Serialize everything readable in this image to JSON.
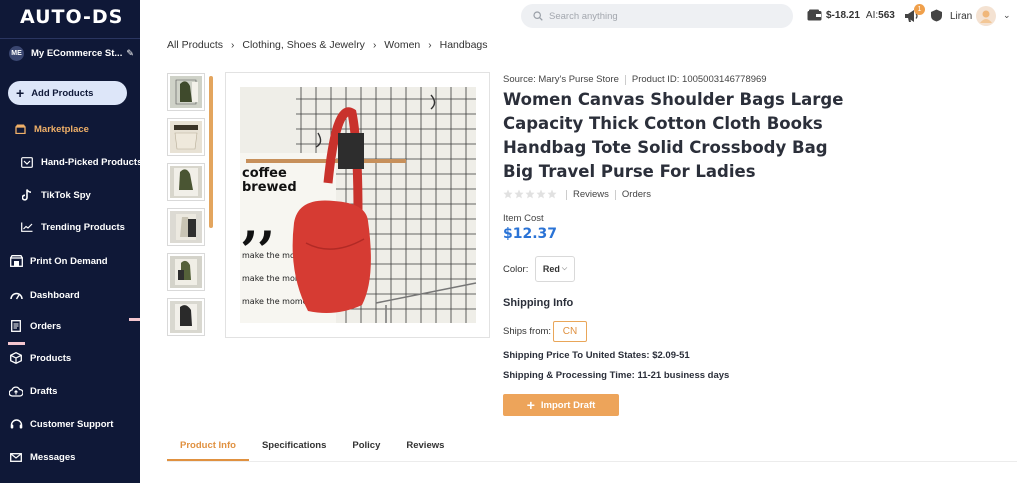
{
  "app": {
    "logo": "AUTO-DS"
  },
  "sidebar": {
    "store_avatar": "ME",
    "store_name": "My ECommerce St...",
    "add_products": "Add Products",
    "marketplace": "Marketplace",
    "hand_picked": "Hand-Picked Products",
    "tiktok_spy": "TikTok Spy",
    "trending": "Trending Products",
    "print_on_demand": "Print On Demand",
    "dashboard": "Dashboard",
    "orders": "Orders",
    "products": "Products",
    "drafts": "Drafts",
    "customer_support": "Customer Support",
    "messages": "Messages"
  },
  "topbar": {
    "search_placeholder": "Search anything",
    "balance": "$-18.21",
    "ai_label": "AI:",
    "ai_count": "563",
    "notification_count": "1",
    "user_name": "Liran"
  },
  "breadcrumb": [
    "All Products",
    "Clothing, Shoes & Jewelry",
    "Women",
    "Handbags"
  ],
  "product": {
    "source_label": "Source:",
    "source": "Mary's Purse Store",
    "id_label": "Product ID:",
    "id": "1005003146778969",
    "title": "Women Canvas Shoulder Bags Large Capacity Thick Cotton Cloth Books Handbag Tote Solid Crossbody Bag Big Travel Purse For Ladies",
    "rating": 0,
    "reviews_label": "Reviews",
    "orders_label": "Orders",
    "item_cost_label": "Item Cost",
    "item_cost": "$12.37",
    "color_label": "Color:",
    "color_value": "Red",
    "shipping_info_label": "Shipping Info",
    "ships_from_label": "Ships from:",
    "ships_from": "CN",
    "ship_price_label": "Shipping Price To United States:",
    "ship_price": "$2.09-51",
    "ship_time_label": "Shipping & Processing Time:",
    "ship_time": "11-21 business days",
    "import_button": "Import Draft",
    "poster_text_1": "coffee",
    "poster_text_2": "brewed",
    "poster_text_3": "make the moment"
  },
  "tabs": [
    "Product Info",
    "Specifications",
    "Policy",
    "Reviews"
  ],
  "colors": {
    "sidebar_bg": "#0f1837",
    "accent_orange": "#eda45a",
    "price_blue": "#2a73d6",
    "bag_red": "#d63b33"
  }
}
